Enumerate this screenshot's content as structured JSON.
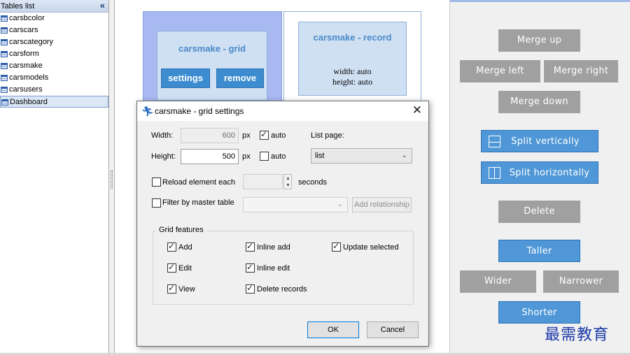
{
  "sidebar": {
    "title": "Tables list",
    "collapse_glyph": "«",
    "items": [
      {
        "label": "carsbcolor",
        "icon": "table-icon"
      },
      {
        "label": "carscars",
        "icon": "table-icon"
      },
      {
        "label": "carscategory",
        "icon": "table-icon"
      },
      {
        "label": "carsform",
        "icon": "table-icon"
      },
      {
        "label": "carsmake",
        "icon": "table-icon"
      },
      {
        "label": "carsmodels",
        "icon": "table-icon"
      },
      {
        "label": "carsusers",
        "icon": "table-icon"
      },
      {
        "label": "Dashboard",
        "icon": "dashboard-icon",
        "selected": true
      }
    ]
  },
  "designer": {
    "grid_cell": {
      "name": "carsmake - grid",
      "settings_label": "settings",
      "remove_label": "remove"
    },
    "record_cell": {
      "name": "carsmake - record",
      "width_text": "width: auto",
      "height_text": "height: auto"
    }
  },
  "right_panel": {
    "merge_up": "Merge up",
    "merge_left": "Merge left",
    "merge_right": "Merge right",
    "merge_down": "Merge down",
    "split_vertically": "Split vertically",
    "split_horizontally": "Split horizontally",
    "delete": "Delete",
    "taller": "Taller",
    "wider": "Wider",
    "narrower": "Narrower",
    "shorter": "Shorter"
  },
  "dialog": {
    "title": "carsmake - grid settings",
    "close_glyph": "✕",
    "width_label": "Width:",
    "width_value": "600",
    "height_label": "Height:",
    "height_value": "500",
    "px_unit": "px",
    "auto_label": "auto",
    "width_auto_checked": true,
    "height_auto_checked": false,
    "list_page_label": "List page:",
    "list_page_value": "list",
    "reload_label": "Reload element each",
    "seconds_label": "seconds",
    "filter_label": "Filter by master table",
    "add_relationship_label": "Add relationship",
    "grid_features_title": "Grid features",
    "features": {
      "add": "Add",
      "inline_add": "Inline add",
      "update_selected": "Update selected",
      "edit": "Edit",
      "inline_edit": "Inline edit",
      "view": "View",
      "delete_records": "Delete records"
    },
    "ok_label": "OK",
    "cancel_label": "Cancel"
  },
  "watermark": "最需教育",
  "colors": {
    "accent_blue": "#4f97d6",
    "gray_button": "#a0a0a0",
    "grid_cell_bg": "#a8b9f2",
    "cell_title": "#4a8ac8"
  }
}
